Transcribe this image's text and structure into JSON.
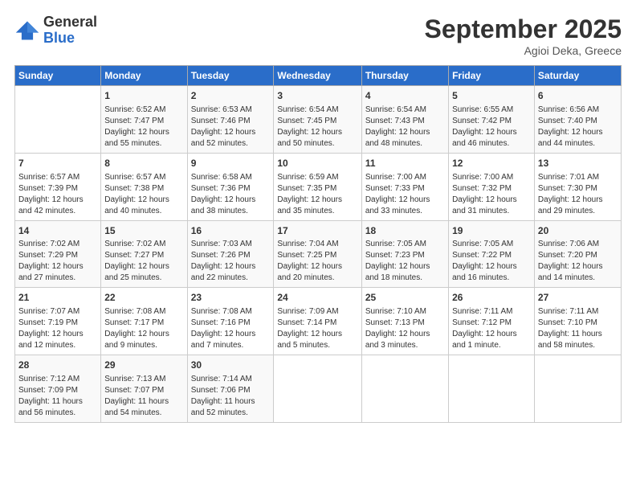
{
  "header": {
    "logo_line1": "General",
    "logo_line2": "Blue",
    "month_title": "September 2025",
    "subtitle": "Agioi Deka, Greece"
  },
  "days_of_week": [
    "Sunday",
    "Monday",
    "Tuesday",
    "Wednesday",
    "Thursday",
    "Friday",
    "Saturday"
  ],
  "weeks": [
    [
      {
        "day": "",
        "info": ""
      },
      {
        "day": "1",
        "info": "Sunrise: 6:52 AM\nSunset: 7:47 PM\nDaylight: 12 hours\nand 55 minutes."
      },
      {
        "day": "2",
        "info": "Sunrise: 6:53 AM\nSunset: 7:46 PM\nDaylight: 12 hours\nand 52 minutes."
      },
      {
        "day": "3",
        "info": "Sunrise: 6:54 AM\nSunset: 7:45 PM\nDaylight: 12 hours\nand 50 minutes."
      },
      {
        "day": "4",
        "info": "Sunrise: 6:54 AM\nSunset: 7:43 PM\nDaylight: 12 hours\nand 48 minutes."
      },
      {
        "day": "5",
        "info": "Sunrise: 6:55 AM\nSunset: 7:42 PM\nDaylight: 12 hours\nand 46 minutes."
      },
      {
        "day": "6",
        "info": "Sunrise: 6:56 AM\nSunset: 7:40 PM\nDaylight: 12 hours\nand 44 minutes."
      }
    ],
    [
      {
        "day": "7",
        "info": "Sunrise: 6:57 AM\nSunset: 7:39 PM\nDaylight: 12 hours\nand 42 minutes."
      },
      {
        "day": "8",
        "info": "Sunrise: 6:57 AM\nSunset: 7:38 PM\nDaylight: 12 hours\nand 40 minutes."
      },
      {
        "day": "9",
        "info": "Sunrise: 6:58 AM\nSunset: 7:36 PM\nDaylight: 12 hours\nand 38 minutes."
      },
      {
        "day": "10",
        "info": "Sunrise: 6:59 AM\nSunset: 7:35 PM\nDaylight: 12 hours\nand 35 minutes."
      },
      {
        "day": "11",
        "info": "Sunrise: 7:00 AM\nSunset: 7:33 PM\nDaylight: 12 hours\nand 33 minutes."
      },
      {
        "day": "12",
        "info": "Sunrise: 7:00 AM\nSunset: 7:32 PM\nDaylight: 12 hours\nand 31 minutes."
      },
      {
        "day": "13",
        "info": "Sunrise: 7:01 AM\nSunset: 7:30 PM\nDaylight: 12 hours\nand 29 minutes."
      }
    ],
    [
      {
        "day": "14",
        "info": "Sunrise: 7:02 AM\nSunset: 7:29 PM\nDaylight: 12 hours\nand 27 minutes."
      },
      {
        "day": "15",
        "info": "Sunrise: 7:02 AM\nSunset: 7:27 PM\nDaylight: 12 hours\nand 25 minutes."
      },
      {
        "day": "16",
        "info": "Sunrise: 7:03 AM\nSunset: 7:26 PM\nDaylight: 12 hours\nand 22 minutes."
      },
      {
        "day": "17",
        "info": "Sunrise: 7:04 AM\nSunset: 7:25 PM\nDaylight: 12 hours\nand 20 minutes."
      },
      {
        "day": "18",
        "info": "Sunrise: 7:05 AM\nSunset: 7:23 PM\nDaylight: 12 hours\nand 18 minutes."
      },
      {
        "day": "19",
        "info": "Sunrise: 7:05 AM\nSunset: 7:22 PM\nDaylight: 12 hours\nand 16 minutes."
      },
      {
        "day": "20",
        "info": "Sunrise: 7:06 AM\nSunset: 7:20 PM\nDaylight: 12 hours\nand 14 minutes."
      }
    ],
    [
      {
        "day": "21",
        "info": "Sunrise: 7:07 AM\nSunset: 7:19 PM\nDaylight: 12 hours\nand 12 minutes."
      },
      {
        "day": "22",
        "info": "Sunrise: 7:08 AM\nSunset: 7:17 PM\nDaylight: 12 hours\nand 9 minutes."
      },
      {
        "day": "23",
        "info": "Sunrise: 7:08 AM\nSunset: 7:16 PM\nDaylight: 12 hours\nand 7 minutes."
      },
      {
        "day": "24",
        "info": "Sunrise: 7:09 AM\nSunset: 7:14 PM\nDaylight: 12 hours\nand 5 minutes."
      },
      {
        "day": "25",
        "info": "Sunrise: 7:10 AM\nSunset: 7:13 PM\nDaylight: 12 hours\nand 3 minutes."
      },
      {
        "day": "26",
        "info": "Sunrise: 7:11 AM\nSunset: 7:12 PM\nDaylight: 12 hours\nand 1 minute."
      },
      {
        "day": "27",
        "info": "Sunrise: 7:11 AM\nSunset: 7:10 PM\nDaylight: 11 hours\nand 58 minutes."
      }
    ],
    [
      {
        "day": "28",
        "info": "Sunrise: 7:12 AM\nSunset: 7:09 PM\nDaylight: 11 hours\nand 56 minutes."
      },
      {
        "day": "29",
        "info": "Sunrise: 7:13 AM\nSunset: 7:07 PM\nDaylight: 11 hours\nand 54 minutes."
      },
      {
        "day": "30",
        "info": "Sunrise: 7:14 AM\nSunset: 7:06 PM\nDaylight: 11 hours\nand 52 minutes."
      },
      {
        "day": "",
        "info": ""
      },
      {
        "day": "",
        "info": ""
      },
      {
        "day": "",
        "info": ""
      },
      {
        "day": "",
        "info": ""
      }
    ]
  ]
}
